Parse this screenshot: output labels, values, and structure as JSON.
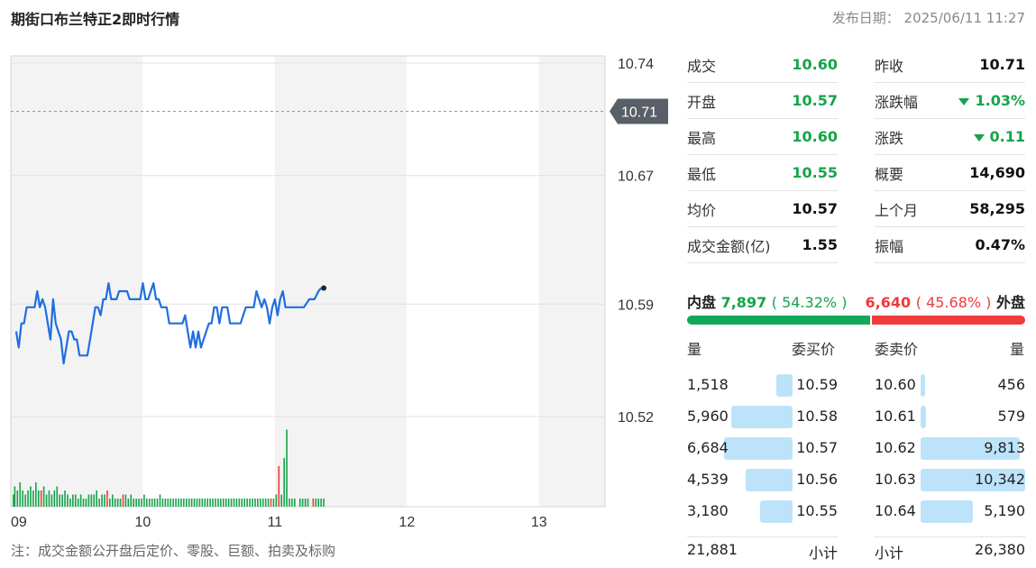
{
  "header": {
    "title": "期街口布兰特正2即时行情",
    "published_label": "发布日期：",
    "published_value": "2025/06/11 11:27"
  },
  "note": "注：成交金额公开盘后定价、零股、巨额、拍卖及标购",
  "colors": {
    "line": "#1f6fe0",
    "up": "#ef3b3b",
    "down": "#16a34a",
    "grid": "#e0e0e0",
    "bandA": "#f3f3f3",
    "bandB": "#ffffff",
    "depth": "#bde3fb"
  },
  "chart_data": {
    "type": "line",
    "x_ticks": [
      "09",
      "10",
      "11",
      "12",
      "13"
    ],
    "y_ticks": [
      "10.74",
      "10.67",
      "10.59",
      "10.52"
    ],
    "ylim": [
      10.52,
      10.74
    ],
    "previous_close": 10.71,
    "previous_close_label": "10.71",
    "x_range_hours": [
      9,
      13.5
    ],
    "price_series": [
      [
        9.04,
        10.573
      ],
      [
        9.06,
        10.563
      ],
      [
        9.08,
        10.578
      ],
      [
        9.1,
        10.578
      ],
      [
        9.12,
        10.588
      ],
      [
        9.15,
        10.588
      ],
      [
        9.18,
        10.588
      ],
      [
        9.2,
        10.598
      ],
      [
        9.22,
        10.588
      ],
      [
        9.24,
        10.593
      ],
      [
        9.26,
        10.588
      ],
      [
        9.28,
        10.578
      ],
      [
        9.3,
        10.568
      ],
      [
        9.32,
        10.593
      ],
      [
        9.34,
        10.578
      ],
      [
        9.36,
        10.573
      ],
      [
        9.38,
        10.568
      ],
      [
        9.4,
        10.553
      ],
      [
        9.42,
        10.563
      ],
      [
        9.44,
        10.573
      ],
      [
        9.46,
        10.573
      ],
      [
        9.48,
        10.568
      ],
      [
        9.5,
        10.568
      ],
      [
        9.52,
        10.558
      ],
      [
        9.56,
        10.558
      ],
      [
        9.58,
        10.558
      ],
      [
        9.6,
        10.568
      ],
      [
        9.62,
        10.578
      ],
      [
        9.64,
        10.588
      ],
      [
        9.66,
        10.588
      ],
      [
        9.68,
        10.583
      ],
      [
        9.7,
        10.593
      ],
      [
        9.72,
        10.593
      ],
      [
        9.74,
        10.603
      ],
      [
        9.76,
        10.593
      ],
      [
        9.78,
        10.593
      ],
      [
        9.8,
        10.593
      ],
      [
        9.82,
        10.598
      ],
      [
        9.84,
        10.598
      ],
      [
        9.88,
        10.598
      ],
      [
        9.9,
        10.593
      ],
      [
        9.95,
        10.593
      ],
      [
        9.98,
        10.593
      ],
      [
        10.0,
        10.603
      ],
      [
        10.02,
        10.593
      ],
      [
        10.04,
        10.593
      ],
      [
        10.06,
        10.598
      ],
      [
        10.08,
        10.603
      ],
      [
        10.1,
        10.593
      ],
      [
        10.12,
        10.593
      ],
      [
        10.14,
        10.588
      ],
      [
        10.16,
        10.588
      ],
      [
        10.18,
        10.588
      ],
      [
        10.2,
        10.578
      ],
      [
        10.22,
        10.578
      ],
      [
        10.26,
        10.578
      ],
      [
        10.3,
        10.578
      ],
      [
        10.32,
        10.583
      ],
      [
        10.34,
        10.573
      ],
      [
        10.36,
        10.563
      ],
      [
        10.38,
        10.573
      ],
      [
        10.4,
        10.563
      ],
      [
        10.42,
        10.573
      ],
      [
        10.44,
        10.563
      ],
      [
        10.46,
        10.568
      ],
      [
        10.5,
        10.578
      ],
      [
        10.52,
        10.578
      ],
      [
        10.54,
        10.588
      ],
      [
        10.56,
        10.588
      ],
      [
        10.58,
        10.578
      ],
      [
        10.6,
        10.588
      ],
      [
        10.62,
        10.588
      ],
      [
        10.64,
        10.588
      ],
      [
        10.66,
        10.578
      ],
      [
        10.7,
        10.578
      ],
      [
        10.74,
        10.578
      ],
      [
        10.76,
        10.583
      ],
      [
        10.78,
        10.588
      ],
      [
        10.8,
        10.588
      ],
      [
        10.84,
        10.588
      ],
      [
        10.86,
        10.598
      ],
      [
        10.88,
        10.593
      ],
      [
        10.9,
        10.588
      ],
      [
        10.92,
        10.593
      ],
      [
        10.94,
        10.588
      ],
      [
        10.96,
        10.578
      ],
      [
        10.98,
        10.588
      ],
      [
        11.0,
        10.593
      ],
      [
        11.02,
        10.583
      ],
      [
        11.04,
        10.593
      ],
      [
        11.06,
        10.598
      ],
      [
        11.08,
        10.588
      ],
      [
        11.1,
        10.588
      ],
      [
        11.14,
        10.588
      ],
      [
        11.18,
        10.588
      ],
      [
        11.22,
        10.588
      ],
      [
        11.26,
        10.593
      ],
      [
        11.3,
        10.593
      ],
      [
        11.33,
        10.598
      ],
      [
        11.35,
        10.6
      ]
    ],
    "last_point": [
      11.37,
      10.6
    ],
    "volume_series": [
      [
        9.02,
        3,
        "g"
      ],
      [
        9.03,
        5,
        "g"
      ],
      [
        9.05,
        4,
        "g"
      ],
      [
        9.07,
        6,
        "g"
      ],
      [
        9.09,
        4,
        "g"
      ],
      [
        9.11,
        3,
        "g"
      ],
      [
        9.13,
        4,
        "g"
      ],
      [
        9.15,
        5,
        "g"
      ],
      [
        9.17,
        4,
        "g"
      ],
      [
        9.19,
        6,
        "g"
      ],
      [
        9.21,
        4,
        "g"
      ],
      [
        9.23,
        4,
        "r"
      ],
      [
        9.25,
        5,
        "g"
      ],
      [
        9.27,
        3,
        "g"
      ],
      [
        9.29,
        4,
        "g"
      ],
      [
        9.31,
        3,
        "g"
      ],
      [
        9.33,
        4,
        "g"
      ],
      [
        9.35,
        5,
        "g"
      ],
      [
        9.37,
        3,
        "g"
      ],
      [
        9.39,
        3,
        "g"
      ],
      [
        9.41,
        4,
        "g"
      ],
      [
        9.43,
        3,
        "g"
      ],
      [
        9.45,
        2,
        "g"
      ],
      [
        9.47,
        3,
        "g"
      ],
      [
        9.49,
        3,
        "g"
      ],
      [
        9.51,
        2,
        "g"
      ],
      [
        9.53,
        3,
        "g"
      ],
      [
        9.55,
        2,
        "g"
      ],
      [
        9.57,
        2,
        "g"
      ],
      [
        9.59,
        3,
        "g"
      ],
      [
        9.61,
        3,
        "g"
      ],
      [
        9.63,
        3,
        "g"
      ],
      [
        9.65,
        4,
        "g"
      ],
      [
        9.67,
        2,
        "g"
      ],
      [
        9.69,
        3,
        "g"
      ],
      [
        9.71,
        3,
        "g"
      ],
      [
        9.73,
        4,
        "r"
      ],
      [
        9.75,
        2,
        "g"
      ],
      [
        9.77,
        3,
        "g"
      ],
      [
        9.79,
        2,
        "g"
      ],
      [
        9.81,
        2,
        "g"
      ],
      [
        9.83,
        2,
        "g"
      ],
      [
        9.85,
        3,
        "r"
      ],
      [
        9.87,
        3,
        "g"
      ],
      [
        9.89,
        2,
        "g"
      ],
      [
        9.91,
        3,
        "g"
      ],
      [
        9.93,
        2,
        "g"
      ],
      [
        9.95,
        2,
        "g"
      ],
      [
        9.97,
        2,
        "g"
      ],
      [
        9.99,
        2,
        "g"
      ],
      [
        10.01,
        3,
        "g"
      ],
      [
        10.03,
        2,
        "g"
      ],
      [
        10.05,
        2,
        "g"
      ],
      [
        10.07,
        2,
        "g"
      ],
      [
        10.09,
        2,
        "g"
      ],
      [
        10.11,
        2,
        "g"
      ],
      [
        10.13,
        3,
        "g"
      ],
      [
        10.15,
        2,
        "g"
      ],
      [
        10.17,
        2,
        "g"
      ],
      [
        10.19,
        2,
        "g"
      ],
      [
        10.21,
        2,
        "g"
      ],
      [
        10.23,
        2,
        "g"
      ],
      [
        10.25,
        2,
        "g"
      ],
      [
        10.27,
        2,
        "g"
      ],
      [
        10.29,
        2,
        "g"
      ],
      [
        10.31,
        2,
        "g"
      ],
      [
        10.33,
        2,
        "g"
      ],
      [
        10.35,
        2,
        "g"
      ],
      [
        10.37,
        2,
        "g"
      ],
      [
        10.39,
        2,
        "g"
      ],
      [
        10.41,
        2,
        "g"
      ],
      [
        10.43,
        2,
        "g"
      ],
      [
        10.45,
        2,
        "g"
      ],
      [
        10.47,
        2,
        "g"
      ],
      [
        10.49,
        2,
        "g"
      ],
      [
        10.51,
        2,
        "g"
      ],
      [
        10.53,
        2,
        "g"
      ],
      [
        10.55,
        2,
        "g"
      ],
      [
        10.57,
        2,
        "g"
      ],
      [
        10.59,
        2,
        "g"
      ],
      [
        10.61,
        2,
        "g"
      ],
      [
        10.63,
        2,
        "g"
      ],
      [
        10.65,
        2,
        "g"
      ],
      [
        10.67,
        2,
        "g"
      ],
      [
        10.69,
        2,
        "g"
      ],
      [
        10.71,
        2,
        "g"
      ],
      [
        10.73,
        2,
        "g"
      ],
      [
        10.75,
        2,
        "g"
      ],
      [
        10.77,
        2,
        "g"
      ],
      [
        10.79,
        2,
        "g"
      ],
      [
        10.81,
        2,
        "g"
      ],
      [
        10.83,
        2,
        "g"
      ],
      [
        10.85,
        2,
        "g"
      ],
      [
        10.87,
        2,
        "g"
      ],
      [
        10.89,
        2,
        "g"
      ],
      [
        10.91,
        2,
        "g"
      ],
      [
        10.93,
        2,
        "g"
      ],
      [
        10.95,
        2,
        "g"
      ],
      [
        10.97,
        2,
        "r"
      ],
      [
        10.99,
        2,
        "g"
      ],
      [
        11.01,
        3,
        "g"
      ],
      [
        11.03,
        10,
        "r"
      ],
      [
        11.05,
        3,
        "g"
      ],
      [
        11.07,
        12,
        "g"
      ],
      [
        11.09,
        19,
        "g"
      ],
      [
        11.11,
        2,
        "g"
      ],
      [
        11.13,
        2,
        "g"
      ],
      [
        11.15,
        2,
        "g"
      ],
      [
        11.19,
        2,
        "g"
      ],
      [
        11.21,
        2,
        "g"
      ],
      [
        11.23,
        2,
        "g"
      ],
      [
        11.25,
        2,
        "g"
      ],
      [
        11.29,
        2,
        "r"
      ],
      [
        11.31,
        2,
        "g"
      ],
      [
        11.33,
        2,
        "g"
      ],
      [
        11.35,
        2,
        "g"
      ],
      [
        11.37,
        2,
        "g"
      ]
    ]
  },
  "stats": {
    "left": [
      {
        "label": "成交",
        "value": "10.60",
        "color": "green"
      },
      {
        "label": "开盘",
        "value": "10.57",
        "color": "green"
      },
      {
        "label": "最高",
        "value": "10.60",
        "color": "green"
      },
      {
        "label": "最低",
        "value": "10.55",
        "color": "green"
      },
      {
        "label": "均价",
        "value": "10.57",
        "color": ""
      },
      {
        "label": "成交金额(亿)",
        "value": "1.55",
        "color": ""
      }
    ],
    "right": [
      {
        "label": "昨收",
        "value": "10.71",
        "color": "",
        "arrow": false
      },
      {
        "label": "涨跌幅",
        "value": "1.03%",
        "color": "green",
        "arrow": true
      },
      {
        "label": "涨跌",
        "value": "0.11",
        "color": "green",
        "arrow": true
      },
      {
        "label": "概要",
        "value": "14,690",
        "color": "",
        "arrow": false
      },
      {
        "label": "上个月",
        "value": "58,295",
        "color": "",
        "arrow": false
      },
      {
        "label": "振幅",
        "value": "0.47%",
        "color": "",
        "arrow": false
      }
    ]
  },
  "inout": {
    "in_label": "内盘",
    "in_value": "7,897",
    "in_pct": "( 54.32% )",
    "in_fraction": 0.5432,
    "out_label": "外盘",
    "out_value": "6,640",
    "out_pct": "( 45.68% )"
  },
  "book": {
    "bid_vol_header": "量",
    "bid_price_header": "委买价",
    "ask_price_header": "委卖价",
    "ask_vol_header": "量",
    "bids": [
      {
        "vol": "1,518",
        "price": "10.59",
        "qty": 1518
      },
      {
        "vol": "5,960",
        "price": "10.58",
        "qty": 5960
      },
      {
        "vol": "6,684",
        "price": "10.57",
        "qty": 6684
      },
      {
        "vol": "4,539",
        "price": "10.56",
        "qty": 4539
      },
      {
        "vol": "3,180",
        "price": "10.55",
        "qty": 3180
      }
    ],
    "asks": [
      {
        "price": "10.60",
        "vol": "456",
        "qty": 456
      },
      {
        "price": "10.61",
        "vol": "579",
        "qty": 579
      },
      {
        "price": "10.62",
        "vol": "9,813",
        "qty": 9813
      },
      {
        "price": "10.63",
        "vol": "10,342",
        "qty": 10342
      },
      {
        "price": "10.64",
        "vol": "5,190",
        "qty": 5190
      }
    ],
    "bid_total": "21,881",
    "bid_total_label": "小计",
    "ask_total_label": "小计",
    "ask_total": "26,380"
  }
}
